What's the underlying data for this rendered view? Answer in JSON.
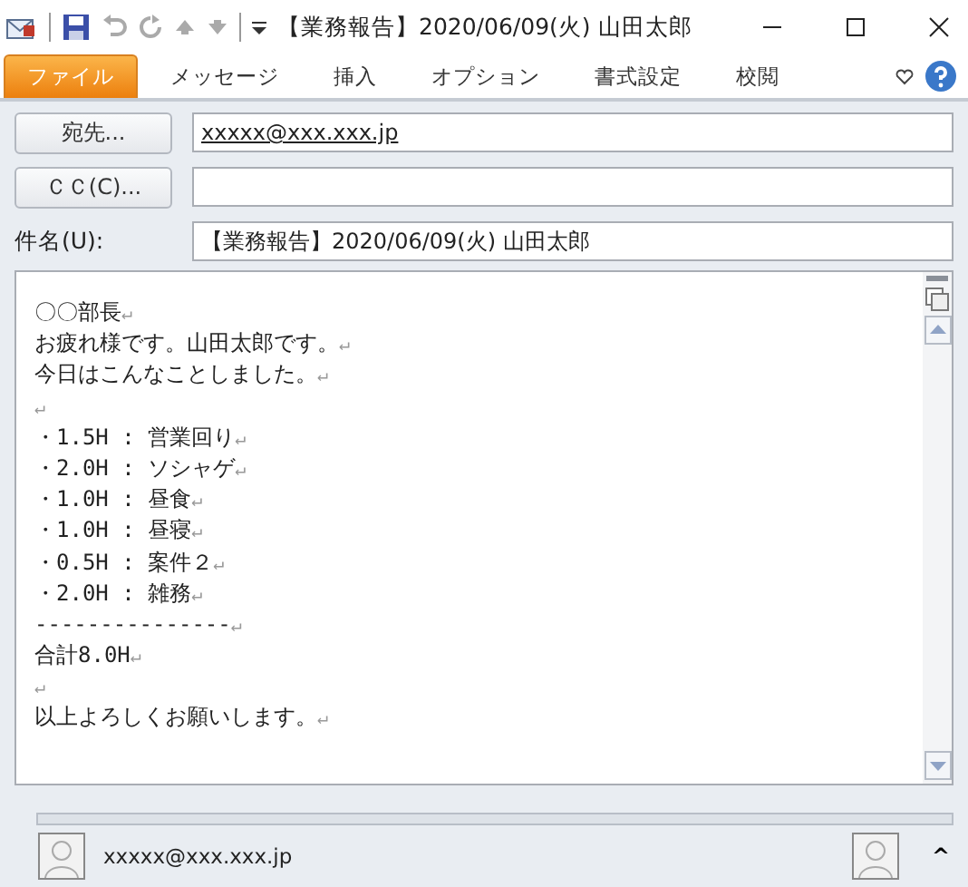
{
  "window": {
    "title": "【業務報告】2020/06/09(火) 山田太郎"
  },
  "tabs": [
    {
      "label": "ファイル",
      "selected": true
    },
    {
      "label": "メッセージ",
      "selected": false
    },
    {
      "label": "挿入",
      "selected": false
    },
    {
      "label": "オプション",
      "selected": false
    },
    {
      "label": "書式設定",
      "selected": false
    },
    {
      "label": "校閲",
      "selected": false
    }
  ],
  "header": {
    "to_button": "宛先...",
    "to_value": "xxxxx@xxx.xxx.jp",
    "cc_button": "ＣＣ(C)...",
    "subject_label": "件名(U):",
    "subject_value": "【業務報告】2020/06/09(火) 山田太郎"
  },
  "body": {
    "mark": "↵",
    "lines": [
      {
        "kind": "text",
        "text": "〇〇部長"
      },
      {
        "kind": "text",
        "text": "お疲れ様です。山田太郎です。"
      },
      {
        "kind": "text",
        "text": "今日はこんなことしました。"
      },
      {
        "kind": "blank"
      },
      {
        "kind": "text",
        "text": "・1.5H : 営業回り"
      },
      {
        "kind": "text",
        "text": "・2.0H : ソシャゲ"
      },
      {
        "kind": "text",
        "text": "・1.0H : 昼食"
      },
      {
        "kind": "text",
        "text": "・1.0H : 昼寝"
      },
      {
        "kind": "text",
        "text": "・0.5H : 案件２"
      },
      {
        "kind": "text",
        "text": "・2.0H : 雑務"
      },
      {
        "kind": "text",
        "text": "---------------"
      },
      {
        "kind": "text",
        "text": "合計8.0H"
      },
      {
        "kind": "blank"
      },
      {
        "kind": "text",
        "text": "以上よろしくお願いします。"
      }
    ]
  },
  "people_pane": {
    "email": "xxxxx@xxx.xxx.jp",
    "expand": "^"
  }
}
